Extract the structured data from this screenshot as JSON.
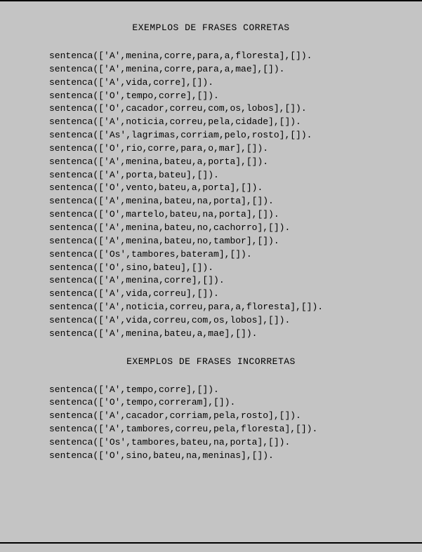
{
  "heading1": "EXEMPLOS DE FRASES CORRETAS",
  "heading2": "EXEMPLOS DE FRASES INCORRETAS",
  "correct_lines": [
    "sentenca(['A',menina,corre,para,a,floresta],[]).",
    "sentenca(['A',menina,corre,para,a,mae],[]).",
    "sentenca(['A',vida,corre],[]).",
    "sentenca(['O',tempo,corre],[]).",
    "sentenca(['O',cacador,correu,com,os,lobos],[]).",
    "sentenca(['A',noticia,correu,pela,cidade],[]).",
    "sentenca(['As',lagrimas,corriam,pelo,rosto],[]).",
    "sentenca(['O',rio,corre,para,o,mar],[]).",
    "sentenca(['A',menina,bateu,a,porta],[]).",
    "sentenca(['A',porta,bateu],[]).",
    "sentenca(['O',vento,bateu,a,porta],[]).",
    "sentenca(['A',menina,bateu,na,porta],[]).",
    "sentenca(['O',martelo,bateu,na,porta],[]).",
    "sentenca(['A',menina,bateu,no,cachorro],[]).",
    "sentenca(['A',menina,bateu,no,tambor],[]).",
    "sentenca(['Os',tambores,bateram],[]).",
    "sentenca(['O',sino,bateu],[]).",
    "sentenca(['A',menina,corre],[]).",
    "sentenca(['A',vida,correu],[]).",
    "sentenca(['A',noticia,correu,para,a,floresta],[]).",
    "sentenca(['A',vida,correu,com,os,lobos],[]).",
    "sentenca(['A',menina,bateu,a,mae],[])."
  ],
  "incorrect_lines": [
    "sentenca(['A',tempo,corre],[]).",
    "sentenca(['O',tempo,correram],[]).",
    "sentenca(['A',cacador,corriam,pela,rosto],[]).",
    "sentenca(['A',tambores,correu,pela,floresta],[]).",
    "sentenca(['Os',tambores,bateu,na,porta],[]).",
    "sentenca(['O',sino,bateu,na,meninas],[])."
  ]
}
